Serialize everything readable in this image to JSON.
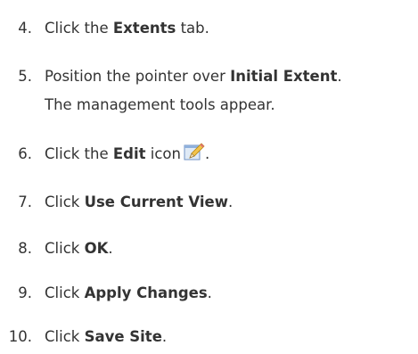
{
  "steps": [
    {
      "num": "4.",
      "pre": "Click the ",
      "bold": "Extents",
      "post": " tab."
    },
    {
      "num": "5.",
      "pre": "Position the pointer over ",
      "bold": "Initial Extent",
      "post": ".",
      "line2": "The management tools appear."
    },
    {
      "num": "6.",
      "pre": "Click the ",
      "bold": "Edit",
      "post": " icon",
      "icon": "edit-pencil-icon",
      "after_icon": "."
    },
    {
      "num": "7.",
      "pre": "Click ",
      "bold": "Use Current View",
      "post": "."
    },
    {
      "num": "8.",
      "pre": "Click ",
      "bold": "OK",
      "post": "."
    },
    {
      "num": "9.",
      "pre": "Click ",
      "bold": "Apply Changes",
      "post": "."
    },
    {
      "num": "10.",
      "pre": "Click ",
      "bold": "Save Site",
      "post": "."
    }
  ]
}
